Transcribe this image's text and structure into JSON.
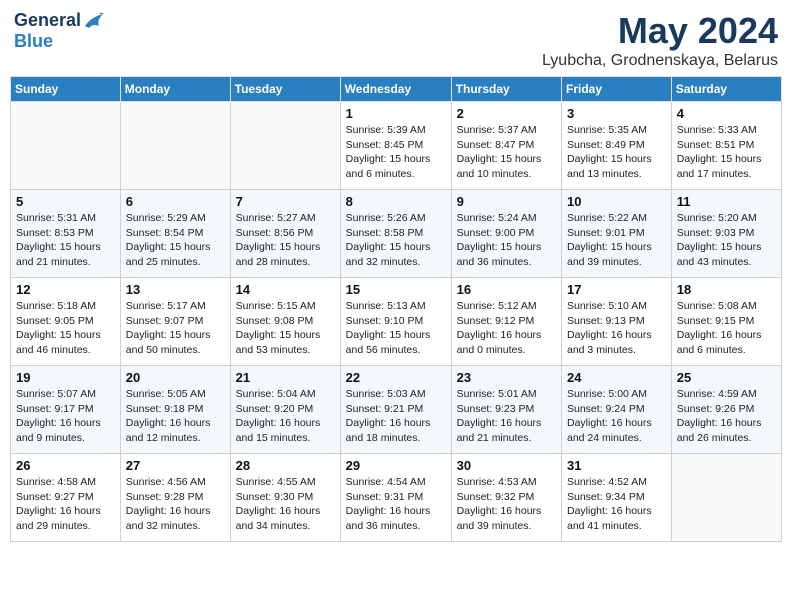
{
  "logo": {
    "general": "General",
    "blue": "Blue"
  },
  "title": "May 2024",
  "location": "Lyubcha, Grodnenskaya, Belarus",
  "days_of_week": [
    "Sunday",
    "Monday",
    "Tuesday",
    "Wednesday",
    "Thursday",
    "Friday",
    "Saturday"
  ],
  "weeks": [
    [
      {
        "num": "",
        "info": ""
      },
      {
        "num": "",
        "info": ""
      },
      {
        "num": "",
        "info": ""
      },
      {
        "num": "1",
        "info": "Sunrise: 5:39 AM\nSunset: 8:45 PM\nDaylight: 15 hours\nand 6 minutes."
      },
      {
        "num": "2",
        "info": "Sunrise: 5:37 AM\nSunset: 8:47 PM\nDaylight: 15 hours\nand 10 minutes."
      },
      {
        "num": "3",
        "info": "Sunrise: 5:35 AM\nSunset: 8:49 PM\nDaylight: 15 hours\nand 13 minutes."
      },
      {
        "num": "4",
        "info": "Sunrise: 5:33 AM\nSunset: 8:51 PM\nDaylight: 15 hours\nand 17 minutes."
      }
    ],
    [
      {
        "num": "5",
        "info": "Sunrise: 5:31 AM\nSunset: 8:53 PM\nDaylight: 15 hours\nand 21 minutes."
      },
      {
        "num": "6",
        "info": "Sunrise: 5:29 AM\nSunset: 8:54 PM\nDaylight: 15 hours\nand 25 minutes."
      },
      {
        "num": "7",
        "info": "Sunrise: 5:27 AM\nSunset: 8:56 PM\nDaylight: 15 hours\nand 28 minutes."
      },
      {
        "num": "8",
        "info": "Sunrise: 5:26 AM\nSunset: 8:58 PM\nDaylight: 15 hours\nand 32 minutes."
      },
      {
        "num": "9",
        "info": "Sunrise: 5:24 AM\nSunset: 9:00 PM\nDaylight: 15 hours\nand 36 minutes."
      },
      {
        "num": "10",
        "info": "Sunrise: 5:22 AM\nSunset: 9:01 PM\nDaylight: 15 hours\nand 39 minutes."
      },
      {
        "num": "11",
        "info": "Sunrise: 5:20 AM\nSunset: 9:03 PM\nDaylight: 15 hours\nand 43 minutes."
      }
    ],
    [
      {
        "num": "12",
        "info": "Sunrise: 5:18 AM\nSunset: 9:05 PM\nDaylight: 15 hours\nand 46 minutes."
      },
      {
        "num": "13",
        "info": "Sunrise: 5:17 AM\nSunset: 9:07 PM\nDaylight: 15 hours\nand 50 minutes."
      },
      {
        "num": "14",
        "info": "Sunrise: 5:15 AM\nSunset: 9:08 PM\nDaylight: 15 hours\nand 53 minutes."
      },
      {
        "num": "15",
        "info": "Sunrise: 5:13 AM\nSunset: 9:10 PM\nDaylight: 15 hours\nand 56 minutes."
      },
      {
        "num": "16",
        "info": "Sunrise: 5:12 AM\nSunset: 9:12 PM\nDaylight: 16 hours\nand 0 minutes."
      },
      {
        "num": "17",
        "info": "Sunrise: 5:10 AM\nSunset: 9:13 PM\nDaylight: 16 hours\nand 3 minutes."
      },
      {
        "num": "18",
        "info": "Sunrise: 5:08 AM\nSunset: 9:15 PM\nDaylight: 16 hours\nand 6 minutes."
      }
    ],
    [
      {
        "num": "19",
        "info": "Sunrise: 5:07 AM\nSunset: 9:17 PM\nDaylight: 16 hours\nand 9 minutes."
      },
      {
        "num": "20",
        "info": "Sunrise: 5:05 AM\nSunset: 9:18 PM\nDaylight: 16 hours\nand 12 minutes."
      },
      {
        "num": "21",
        "info": "Sunrise: 5:04 AM\nSunset: 9:20 PM\nDaylight: 16 hours\nand 15 minutes."
      },
      {
        "num": "22",
        "info": "Sunrise: 5:03 AM\nSunset: 9:21 PM\nDaylight: 16 hours\nand 18 minutes."
      },
      {
        "num": "23",
        "info": "Sunrise: 5:01 AM\nSunset: 9:23 PM\nDaylight: 16 hours\nand 21 minutes."
      },
      {
        "num": "24",
        "info": "Sunrise: 5:00 AM\nSunset: 9:24 PM\nDaylight: 16 hours\nand 24 minutes."
      },
      {
        "num": "25",
        "info": "Sunrise: 4:59 AM\nSunset: 9:26 PM\nDaylight: 16 hours\nand 26 minutes."
      }
    ],
    [
      {
        "num": "26",
        "info": "Sunrise: 4:58 AM\nSunset: 9:27 PM\nDaylight: 16 hours\nand 29 minutes."
      },
      {
        "num": "27",
        "info": "Sunrise: 4:56 AM\nSunset: 9:28 PM\nDaylight: 16 hours\nand 32 minutes."
      },
      {
        "num": "28",
        "info": "Sunrise: 4:55 AM\nSunset: 9:30 PM\nDaylight: 16 hours\nand 34 minutes."
      },
      {
        "num": "29",
        "info": "Sunrise: 4:54 AM\nSunset: 9:31 PM\nDaylight: 16 hours\nand 36 minutes."
      },
      {
        "num": "30",
        "info": "Sunrise: 4:53 AM\nSunset: 9:32 PM\nDaylight: 16 hours\nand 39 minutes."
      },
      {
        "num": "31",
        "info": "Sunrise: 4:52 AM\nSunset: 9:34 PM\nDaylight: 16 hours\nand 41 minutes."
      },
      {
        "num": "",
        "info": ""
      }
    ]
  ]
}
